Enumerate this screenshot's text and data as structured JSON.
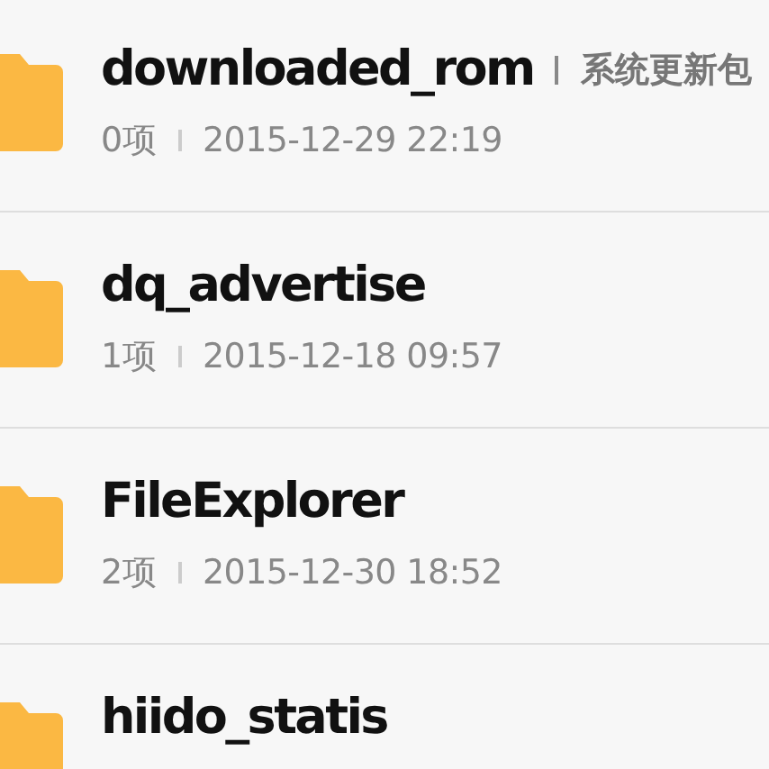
{
  "folders": [
    {
      "name": "downloaded_rom",
      "note": "系统更新包",
      "count": "0项",
      "modified": "2015-12-29 22:19"
    },
    {
      "name": "dq_advertise",
      "count": "1项",
      "modified": "2015-12-18 09:57"
    },
    {
      "name": "FileExplorer",
      "count": "2项",
      "modified": "2015-12-30 18:52"
    },
    {
      "name": "hiido_statis"
    }
  ]
}
